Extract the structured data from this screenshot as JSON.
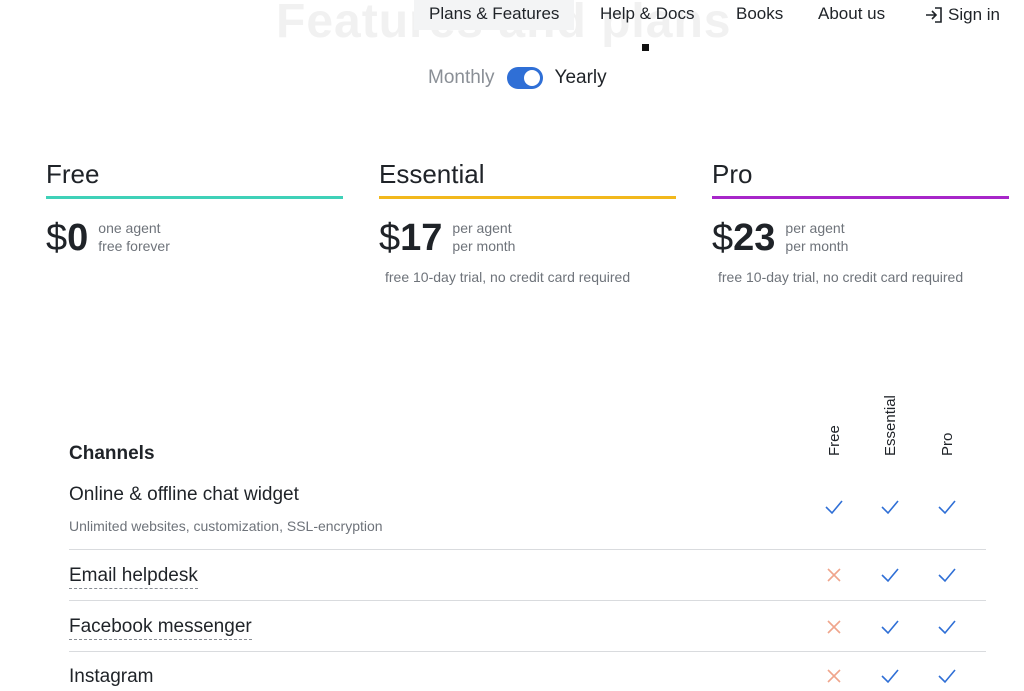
{
  "header": {
    "background_title": "Features and plans",
    "nav": [
      {
        "label": "Plans & Features"
      },
      {
        "label": "Help & Docs"
      },
      {
        "label": "Books"
      },
      {
        "label": "About us"
      },
      {
        "label": "Sign in",
        "icon": "sign-in-icon"
      }
    ]
  },
  "billing": {
    "monthly_label": "Monthly",
    "yearly_label": "Yearly",
    "yearly_selected": true,
    "toggle_color": "#2f6fd6"
  },
  "plans": [
    {
      "name": "Free",
      "currency": "$",
      "amount": "0",
      "note_line1": "one agent",
      "note_line2": "free forever",
      "trial": "",
      "accent": "#3fd1b8"
    },
    {
      "name": "Essential",
      "currency": "$",
      "amount": "17",
      "note_line1": "per agent",
      "note_line2": "per month",
      "trial": "free 10-day trial, no credit card required",
      "accent": "#f2b81c"
    },
    {
      "name": "Pro",
      "currency": "$",
      "amount": "23",
      "note_line1": "per agent",
      "note_line2": "per month",
      "trial": "free 10-day trial, no credit card required",
      "accent": "#a726c9"
    }
  ],
  "table": {
    "columns": [
      "Free",
      "Essential",
      "Pro"
    ],
    "section": "Channels",
    "rows": [
      {
        "title": "Online & offline chat widget",
        "subtitle": "Unlimited websites, customization, SSL-encryption",
        "availability": [
          true,
          true,
          true
        ]
      },
      {
        "title": "Email helpdesk",
        "subtitle": "",
        "availability": [
          false,
          true,
          true
        ]
      },
      {
        "title": "Facebook messenger",
        "subtitle": "",
        "availability": [
          false,
          true,
          true
        ]
      },
      {
        "title": "Instagram",
        "subtitle": "",
        "availability": [
          false,
          true,
          true
        ]
      }
    ],
    "check_color": "#2f6fd6",
    "cross_color": "#f0a58c"
  }
}
